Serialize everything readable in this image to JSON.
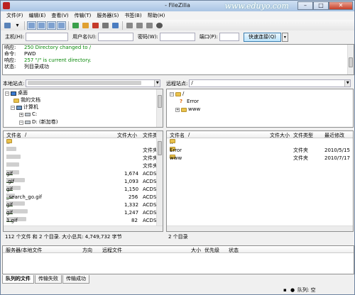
{
  "window": {
    "title": "- FileZilla",
    "watermark": "www.eduyo.com"
  },
  "menu": [
    "文件(F)",
    "编辑(E)",
    "查看(V)",
    "传输(T)",
    "服务器(S)",
    "书签(B)",
    "帮助(H)"
  ],
  "quickconnect": {
    "host_label": "主机(H):",
    "user_label": "用户名(U):",
    "pass_label": "密码(W):",
    "port_label": "端口(P):",
    "button": "快速连接(Q)"
  },
  "log": [
    {
      "k": "响应:",
      "v": "250 Directory changed to /",
      "green": true
    },
    {
      "k": "命令:",
      "v": "PWD",
      "green": false
    },
    {
      "k": "响应:",
      "v": "257 \"/\" is current directory.",
      "green": true
    },
    {
      "k": "状态:",
      "v": "列目录成功",
      "green": false
    }
  ],
  "local": {
    "site_label": "本地站点:",
    "tree": [
      "桌面",
      "我的文档",
      "计算机",
      "C:",
      "D: (新加卷)"
    ],
    "headers": {
      "name": "文件名",
      "size": "文件大小",
      "type": "文件类"
    },
    "files": [
      {
        "name": "..",
        "size": "",
        "type": ""
      },
      {
        "name": "",
        "size": "",
        "type": "文件夹"
      },
      {
        "name": "",
        "size": "",
        "type": "文件夹"
      },
      {
        "name": "",
        "size": "",
        "type": "文件夹"
      },
      {
        "name": "gif",
        "size": "1,674",
        "type": "ACDS"
      },
      {
        "name": ".gif",
        "size": "1,093",
        "type": "ACDS"
      },
      {
        "name": "gif",
        "size": "1,150",
        "type": "ACDS"
      },
      {
        "name": "_search_go.gif",
        "size": "256",
        "type": "ACDS"
      },
      {
        "name": "gif",
        "size": "1,332",
        "type": "ACDS"
      },
      {
        "name": "gif",
        "size": "1,247",
        "type": "ACDS"
      },
      {
        "name": "1.gif",
        "size": "82",
        "type": "ACDS"
      }
    ],
    "status": "112 个文件 和 2 个目录. 大小总共: 4,749,732 字节"
  },
  "remote": {
    "site_label": "远程站点:",
    "site_value": "/",
    "tree": [
      "/",
      "Error",
      "www"
    ],
    "headers": {
      "name": "文件名",
      "size": "文件大小",
      "type": "文件类型",
      "modified": "最近修改"
    },
    "files": [
      {
        "name": "..",
        "size": "",
        "type": "",
        "modified": ""
      },
      {
        "name": "Error",
        "size": "",
        "type": "文件夹",
        "modified": "2010/5/15"
      },
      {
        "name": "www",
        "size": "",
        "type": "文件夹",
        "modified": "2010/7/17"
      }
    ],
    "status": "2 个目录"
  },
  "queue": {
    "headers": {
      "server": "服务器/本地文件",
      "direction": "方向",
      "remote": "远程文件",
      "size": "大小",
      "priority": "优先级",
      "status": "状态"
    }
  },
  "tabs": [
    "队列的文件",
    "传输失败",
    "传输成功"
  ],
  "bottom": {
    "queue_label": "队列: 空"
  },
  "colors": {
    "accent": "#3c7fb1",
    "folder": "#e9c24c",
    "log_green": "#0a8a0a"
  }
}
